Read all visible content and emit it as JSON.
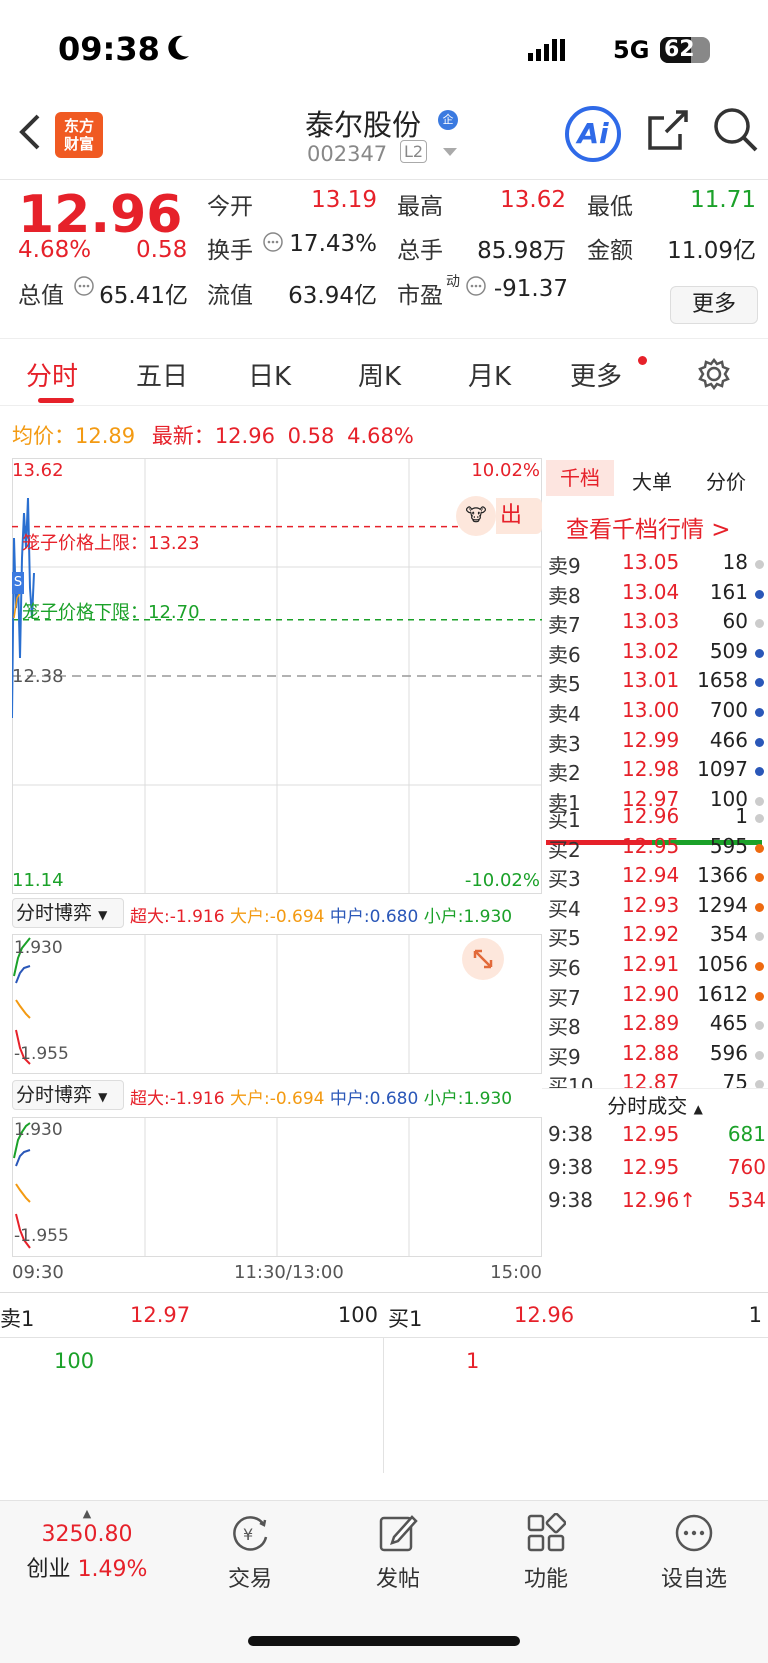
{
  "status_bar": {
    "time": "09:38",
    "network": "5G",
    "battery": "62",
    "battery_level": 0.62
  },
  "header": {
    "logo": [
      "东方",
      "财富"
    ],
    "stock_name": "泰尔股份",
    "badge": "企",
    "code": "002347",
    "level": "L2",
    "ai": "Ai"
  },
  "quote": {
    "price": "12.96",
    "change_pct": "4.68%",
    "change": "0.58",
    "open_label": "今开",
    "open": "13.19",
    "high_label": "最高",
    "high": "13.62",
    "low_label": "最低",
    "low": "11.71",
    "turnover_label": "换手",
    "turnover": "17.43%",
    "volume_label": "总手",
    "volume": "85.98万",
    "amount_label": "金额",
    "amount": "11.09亿",
    "mcap_label": "总值",
    "mcap": "65.41亿",
    "float_label": "流值",
    "float_cap": "63.94亿",
    "pe_label": "市盈",
    "pe_sup": "动",
    "pe": "-91.37",
    "more": "更多"
  },
  "tabs": [
    "分时",
    "五日",
    "日K",
    "周K",
    "月K",
    "更多"
  ],
  "summary": {
    "avg_label": "均价：",
    "avg": "12.89",
    "latest_label": "最新：",
    "latest": "12.96",
    "change": "0.58",
    "pct": "4.68%"
  },
  "chart": {
    "top_price": "13.62",
    "top_pct": "10.02%",
    "bottom_price": "11.14",
    "bottom_pct": "-10.02%",
    "prev_close": "12.38",
    "upper_label": "笼子价格上限：13.23",
    "lower_label": "笼子价格下限：12.70",
    "upper_price": 13.23,
    "lower_price": 12.7,
    "time_labels": [
      "09:30",
      "11:30/13:00",
      "15:00"
    ],
    "out_label": "出",
    "s_label": "S"
  },
  "game_panels": [
    {
      "select": "分时博弈",
      "legend": [
        {
          "name": "超大:",
          "value": "-1.916"
        },
        {
          "name": "大户:",
          "value": "-0.694"
        },
        {
          "name": "中户:",
          "value": "0.680"
        },
        {
          "name": "小户:",
          "value": "1.930"
        }
      ],
      "top": "1.930",
      "bottom": "-1.955"
    },
    {
      "select": "分时博弈",
      "legend": [
        {
          "name": "超大:",
          "value": "-1.916"
        },
        {
          "name": "大户:",
          "value": "-0.694"
        },
        {
          "name": "中户:",
          "value": "0.680"
        },
        {
          "name": "小户:",
          "value": "1.930"
        }
      ],
      "top": "1.930",
      "bottom": "-1.955"
    }
  ],
  "book": {
    "tabs": [
      "千档",
      "大单",
      "分价"
    ],
    "view_all": "查看千档行情 >",
    "asks": [
      {
        "l": "卖9",
        "p": "13.05",
        "v": "18",
        "c": "#cccccc"
      },
      {
        "l": "卖8",
        "p": "13.04",
        "v": "161",
        "c": "#2a57b8"
      },
      {
        "l": "卖7",
        "p": "13.03",
        "v": "60",
        "c": "#cccccc"
      },
      {
        "l": "卖6",
        "p": "13.02",
        "v": "509",
        "c": "#2a57b8"
      },
      {
        "l": "卖5",
        "p": "13.01",
        "v": "1658",
        "c": "#2a57b8"
      },
      {
        "l": "卖4",
        "p": "13.00",
        "v": "700",
        "c": "#2a57b8"
      },
      {
        "l": "卖3",
        "p": "12.99",
        "v": "466",
        "c": "#2a57b8"
      },
      {
        "l": "卖2",
        "p": "12.98",
        "v": "1097",
        "c": "#2a57b8"
      },
      {
        "l": "卖1",
        "p": "12.97",
        "v": "100",
        "c": "#cccccc"
      }
    ],
    "bids": [
      {
        "l": "买1",
        "p": "12.96",
        "v": "1",
        "c": "#cccccc"
      },
      {
        "l": "买2",
        "p": "12.95",
        "v": "595",
        "c": "#ee6a10"
      },
      {
        "l": "买3",
        "p": "12.94",
        "v": "1366",
        "c": "#ee6a10"
      },
      {
        "l": "买4",
        "p": "12.93",
        "v": "1294",
        "c": "#ee6a10"
      },
      {
        "l": "买5",
        "p": "12.92",
        "v": "354",
        "c": "#cccccc"
      },
      {
        "l": "买6",
        "p": "12.91",
        "v": "1056",
        "c": "#ee6a10"
      },
      {
        "l": "买7",
        "p": "12.90",
        "v": "1612",
        "c": "#ee6a10"
      },
      {
        "l": "买8",
        "p": "12.89",
        "v": "465",
        "c": "#cccccc"
      },
      {
        "l": "买9",
        "p": "12.88",
        "v": "596",
        "c": "#cccccc"
      },
      {
        "l": "买10",
        "p": "12.87",
        "v": "75",
        "c": "#cccccc"
      }
    ],
    "trades_title": "分时成交",
    "trades": [
      {
        "t": "9:38",
        "p": "12.95",
        "v": "681",
        "vc": "#1ba129"
      },
      {
        "t": "9:38",
        "p": "12.95",
        "v": "760",
        "vc": "#e6212a"
      },
      {
        "t": "9:38",
        "p": "12.96↑",
        "v": "534",
        "vc": "#e6212a"
      }
    ]
  },
  "bottom": {
    "sell_label": "卖1",
    "sell_price": "12.97",
    "sell_vol": "100",
    "buy_label": "买1",
    "buy_price": "12.96",
    "buy_vol": "1",
    "sell_qty": "100",
    "buy_qty": "1"
  },
  "tabbar": {
    "index_value": "3250.80",
    "index_name": "创业",
    "index_pct": "1.49%",
    "items": [
      "交易",
      "发帖",
      "功能",
      "设自选"
    ]
  }
}
